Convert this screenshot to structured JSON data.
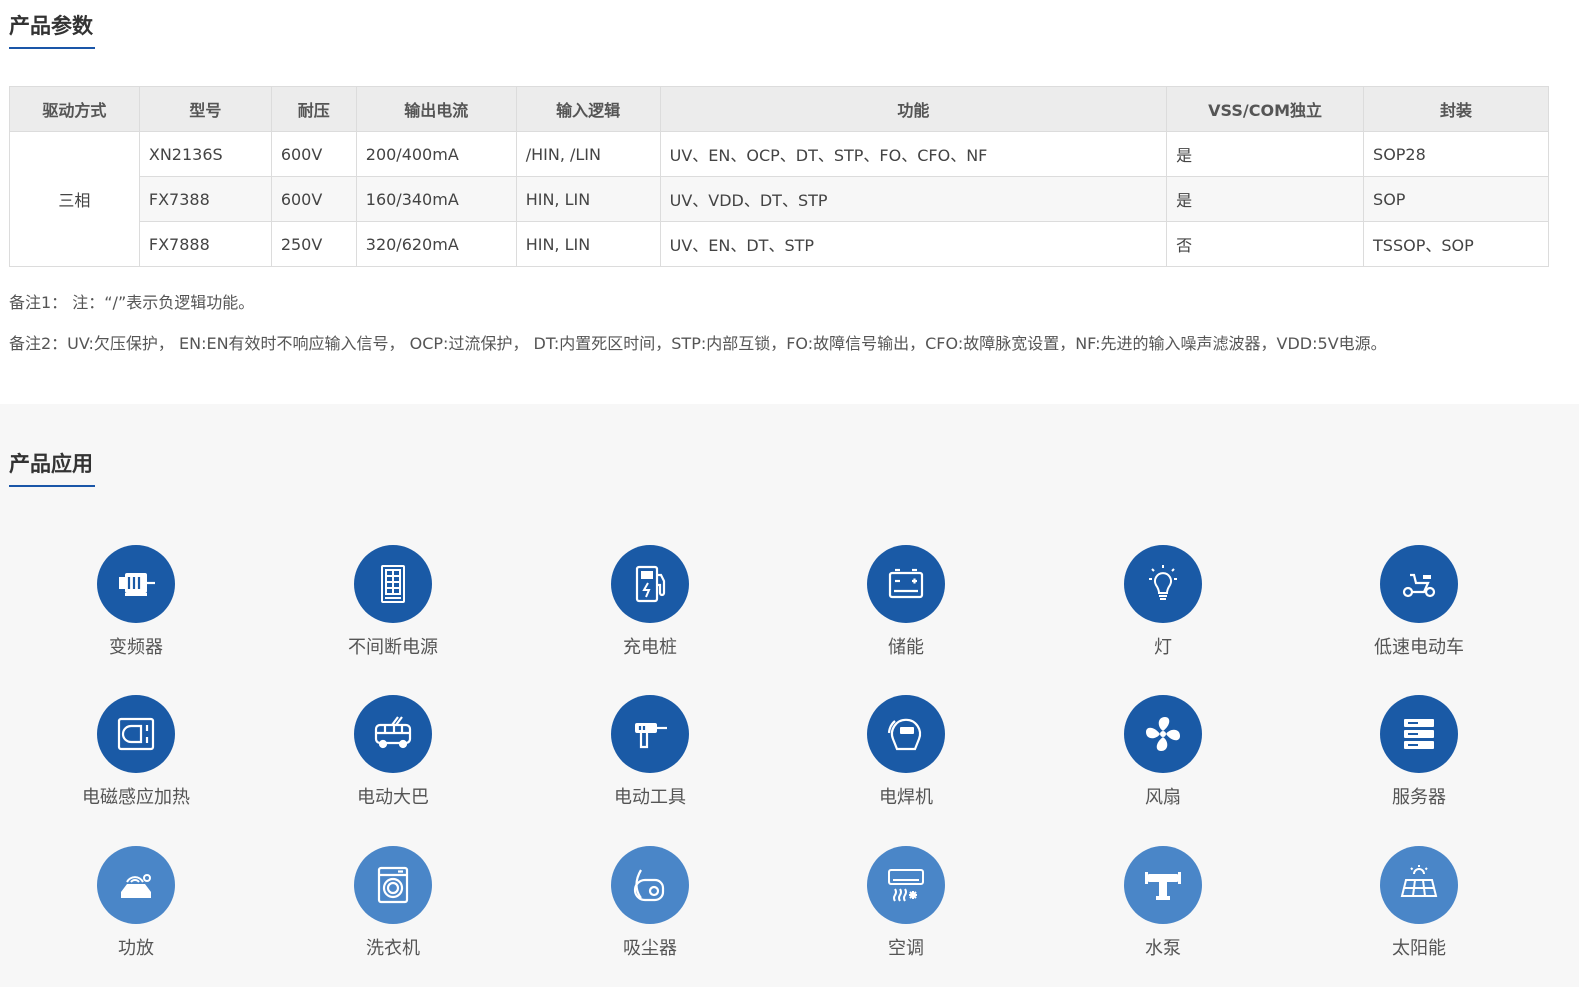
{
  "params": {
    "title": "产品参数",
    "headers": [
      "驱动方式",
      "型号",
      "耐压",
      "输出电流",
      "输入逻辑",
      "功能",
      "VSS/COM独立",
      "封装"
    ],
    "drive": "三相",
    "rows": [
      [
        "XN2136S",
        "600V",
        "200/400mA",
        "/HIN, /LIN",
        "UV、EN、OCP、DT、STP、FO、CFO、NF",
        "是",
        "SOP28"
      ],
      [
        "FX7388",
        "600V",
        "160/340mA",
        "HIN, LIN",
        "UV、VDD、DT、STP",
        "是",
        "SOP"
      ],
      [
        "FX7888",
        "250V",
        "320/620mA",
        "HIN, LIN",
        "UV、EN、DT、STP",
        "否",
        "TSSOP、SOP"
      ]
    ],
    "note1": "备注1： 注：“/”表示负逻辑功能。",
    "note2": "备注2：UV:欠压保护， EN:EN有效时不响应输入信号， OCP:过流保护， DT:内置死区时间，STP:内部互锁，FO:故障信号输出，CFO:故障脉宽设置，NF:先进的输入噪声滤波器，VDD:5V电源。"
  },
  "apps": {
    "title": "产品应用",
    "items": [
      {
        "label": "变频器",
        "icon": "motor-icon"
      },
      {
        "label": "不间断电源",
        "icon": "ups-cabinet-icon"
      },
      {
        "label": "充电桩",
        "icon": "charging-pile-icon"
      },
      {
        "label": "储能",
        "icon": "battery-icon"
      },
      {
        "label": "灯",
        "icon": "light-bulb-icon"
      },
      {
        "label": "低速电动车",
        "icon": "scooter-icon"
      },
      {
        "label": "电磁感应加热",
        "icon": "induction-cooker-icon"
      },
      {
        "label": "电动大巴",
        "icon": "bus-icon"
      },
      {
        "label": "电动工具",
        "icon": "drill-icon"
      },
      {
        "label": "电焊机",
        "icon": "welding-mask-icon"
      },
      {
        "label": "风扇",
        "icon": "fan-icon"
      },
      {
        "label": "服务器",
        "icon": "server-icon"
      },
      {
        "label": "功放",
        "icon": "amplifier-icon"
      },
      {
        "label": "洗衣机",
        "icon": "washing-machine-icon"
      },
      {
        "label": "吸尘器",
        "icon": "vacuum-cleaner-icon"
      },
      {
        "label": "空调",
        "icon": "air-conditioner-icon"
      },
      {
        "label": "水泵",
        "icon": "water-pump-icon"
      },
      {
        "label": "太阳能",
        "icon": "solar-panel-icon"
      }
    ]
  },
  "colors": {
    "accent": "#1a56a8",
    "icon_dark": "#1a5aa6",
    "icon_light": "#4a86c8"
  }
}
